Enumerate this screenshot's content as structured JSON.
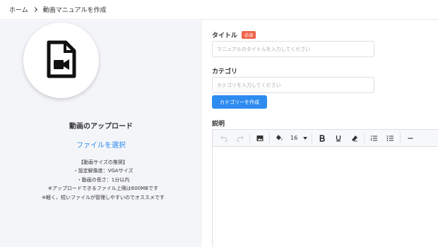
{
  "breadcrumb": {
    "home": "ホーム",
    "current": "動画マニュアルを作成"
  },
  "upload": {
    "icon": "video-file-icon",
    "title": "動画のアップロード",
    "file_select": "ファイルを選択",
    "guide": [
      "【動画サイズの推奨】",
      "・設定解像度：VGAサイズ",
      "・動画の長さ：1分以内",
      "※アップロードできるファイル上限は600MBです",
      "※軽く、短いファイルが管理しやすいのでオススメです"
    ]
  },
  "form": {
    "title_label": "タイトル",
    "required_badge": "必須",
    "title_placeholder": "マニュアルのタイトルを入力してください",
    "category_label": "カテゴリ",
    "category_placeholder": "カテゴリを入力してください",
    "create_category_button": "カテゴリーを作成",
    "description_label": "説明"
  },
  "toolbar": {
    "font_size": "16",
    "icons": [
      "undo-icon",
      "redo-icon",
      "image-icon",
      "fill-color-icon",
      "bold-icon",
      "underline-icon",
      "eraser-icon",
      "ordered-list-icon",
      "bullet-list-icon",
      "horizontal-rule-icon"
    ]
  },
  "colors": {
    "accent": "#2e8bef",
    "link": "#2c8cf0",
    "required": "#f0634a",
    "left_bg": "#f4f5f9"
  }
}
